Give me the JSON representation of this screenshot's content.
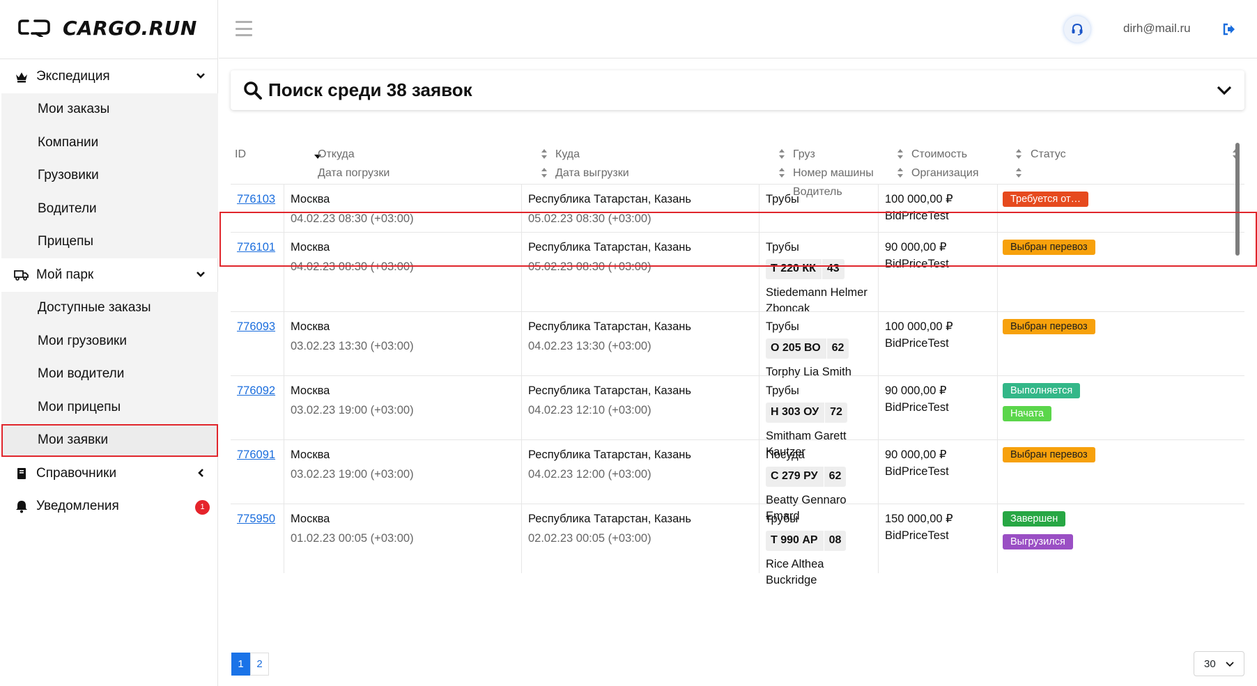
{
  "app": {
    "logo_text": "CARGO.RUN"
  },
  "header": {
    "user_email": "dirh@mail.ru"
  },
  "sidebar": {
    "groups": [
      {
        "label": "Экспедиция",
        "items": [
          "Мои заказы",
          "Компании",
          "Грузовики",
          "Водители",
          "Прицепы"
        ]
      },
      {
        "label": "Мой парк",
        "items": [
          "Доступные заказы",
          "Мои грузовики",
          "Мои водители",
          "Мои прицепы",
          "Мои заявки"
        ]
      },
      {
        "label": "Справочники"
      },
      {
        "label": "Уведомления",
        "badge": "1"
      }
    ],
    "active_item": "Мои заявки"
  },
  "search": {
    "title": "Поиск среди 38 заявок"
  },
  "table": {
    "headers": {
      "id": "ID",
      "from": "Откуда",
      "load_date": "Дата погрузки",
      "to": "Куда",
      "unload_date": "Дата выгрузки",
      "cargo": "Груз",
      "truck_number": "Номер машины",
      "driver": "Водитель",
      "cost": "Стоимость",
      "organization": "Организация",
      "status": "Статус"
    },
    "rows": [
      {
        "id": "776103",
        "from": "Москва",
        "load_date": "04.02.23 08:30 (+03:00)",
        "to": "Республика Татарстан, Казань",
        "unload_date": "05.02.23 08:30 (+03:00)",
        "cargo": "Трубы",
        "plate": "",
        "region": "",
        "driver": "",
        "cost": "100 000,00 ₽",
        "org": "BidPriceTest",
        "statuses": [
          {
            "label": "Требуется от…",
            "color": "red"
          }
        ]
      },
      {
        "id": "776101",
        "from": "Москва",
        "load_date": "04.02.23 08:30 (+03:00)",
        "to": "Республика Татарстан, Казань",
        "unload_date": "05.02.23 08:30 (+03:00)",
        "cargo": "Трубы",
        "plate": "Т 220 КК",
        "region": "43",
        "driver": "Stiedemann Helmer Zboncak",
        "cost": "90 000,00 ₽",
        "org": "BidPriceTest",
        "statuses": [
          {
            "label": "Выбран перевоз",
            "color": "orange"
          }
        ]
      },
      {
        "id": "776093",
        "from": "Москва",
        "load_date": "03.02.23 13:30 (+03:00)",
        "to": "Республика Татарстан, Казань",
        "unload_date": "04.02.23 13:30 (+03:00)",
        "cargo": "Трубы",
        "plate": "О 205 ВО",
        "region": "62",
        "driver": "Torphy Lia Smith",
        "cost": "100 000,00 ₽",
        "org": "BidPriceTest",
        "statuses": [
          {
            "label": "Выбран перевоз",
            "color": "orange"
          }
        ]
      },
      {
        "id": "776092",
        "from": "Москва",
        "load_date": "03.02.23 19:00 (+03:00)",
        "to": "Республика Татарстан, Казань",
        "unload_date": "04.02.23 12:10 (+03:00)",
        "cargo": "Трубы",
        "plate": "Н 303 ОУ",
        "region": "72",
        "driver": "Smitham Garett Kautzer",
        "cost": "90 000,00 ₽",
        "org": "BidPriceTest",
        "statuses": [
          {
            "label": "Выполняется",
            "color": "teal"
          },
          {
            "label": "Начата",
            "color": "lime"
          }
        ]
      },
      {
        "id": "776091",
        "from": "Москва",
        "load_date": "03.02.23 19:00 (+03:00)",
        "to": "Республика Татарстан, Казань",
        "unload_date": "04.02.23 12:00 (+03:00)",
        "cargo": "Посуда",
        "plate": "С 279 РУ",
        "region": "62",
        "driver": "Beatty Gennaro Emard",
        "cost": "90 000,00 ₽",
        "org": "BidPriceTest",
        "statuses": [
          {
            "label": "Выбран перевоз",
            "color": "orange"
          }
        ]
      },
      {
        "id": "775950",
        "from": "Москва",
        "load_date": "01.02.23 00:05 (+03:00)",
        "to": "Республика Татарстан, Казань",
        "unload_date": "02.02.23 00:05 (+03:00)",
        "cargo": "трубы",
        "plate": "Т 990 АР",
        "region": "08",
        "driver": "Rice Althea Buckridge",
        "cost": "150 000,00 ₽",
        "org": "BidPriceTest",
        "statuses": [
          {
            "label": "Завершен",
            "color": "green"
          },
          {
            "label": "Выгрузился",
            "color": "purple"
          }
        ]
      }
    ]
  },
  "pagination": {
    "pages": [
      "1",
      "2"
    ],
    "current": "1",
    "per_page": "30"
  },
  "colors": {
    "link": "#1a6ddd",
    "highlight_border": "#e0262c",
    "active_page": "#1a73e8",
    "notification_badge": "#e5242b"
  }
}
